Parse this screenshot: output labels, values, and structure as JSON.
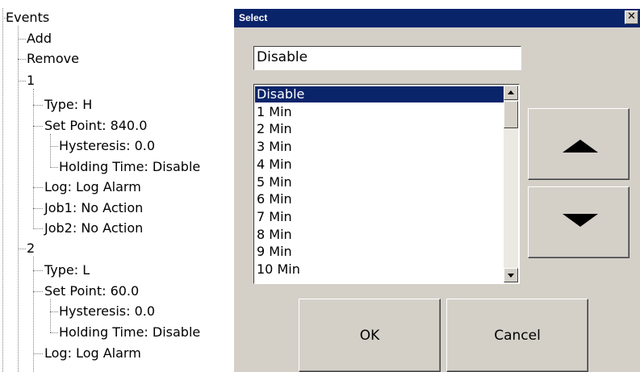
{
  "tree": {
    "items": [
      {
        "label": "Events"
      },
      {
        "label": "Add"
      },
      {
        "label": "Remove"
      },
      {
        "label": "1"
      },
      {
        "label": "Type: H"
      },
      {
        "label": "Set Point: 840.0"
      },
      {
        "label": "Hysteresis: 0.0"
      },
      {
        "label": "Holding Time: Disable"
      },
      {
        "label": "Log: Log Alarm"
      },
      {
        "label": "Job1: No Action"
      },
      {
        "label": "Job2: No Action"
      },
      {
        "label": "2"
      },
      {
        "label": "Type: L"
      },
      {
        "label": "Set Point: 60.0"
      },
      {
        "label": "Hysteresis: 0.0"
      },
      {
        "label": "Holding Time: Disable"
      },
      {
        "label": "Log: Log Alarm"
      }
    ]
  },
  "dialog": {
    "title": "Select",
    "close_glyph": "✕",
    "current_value": "Disable",
    "options": [
      "Disable",
      "1 Min",
      "2 Min",
      "3 Min",
      "4 Min",
      "5 Min",
      "6 Min",
      "7 Min",
      "8 Min",
      "9 Min",
      "10 Min"
    ],
    "selected_index": 0,
    "up_icon": "triangle-up-icon",
    "down_icon": "triangle-down-icon",
    "ok_label": "OK",
    "cancel_label": "Cancel",
    "colors": {
      "titlebar": "#0a246a",
      "selection": "#0a246a",
      "face": "#d4d0c8"
    }
  }
}
